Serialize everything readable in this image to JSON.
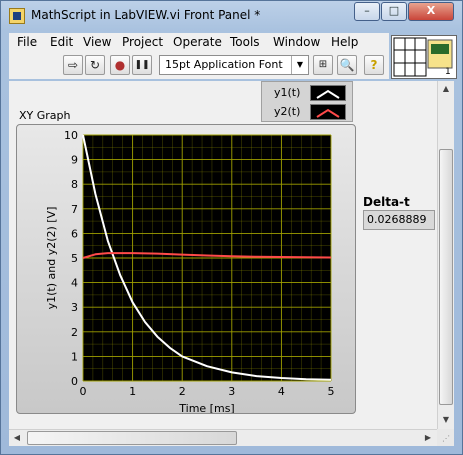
{
  "window": {
    "title": "MathScript in LabVIEW.vi Front Panel *",
    "controls": {
      "minimize": "–",
      "maximize": "□",
      "close": "X"
    }
  },
  "menu": [
    "File",
    "Edit",
    "View",
    "Project",
    "Operate",
    "Tools",
    "Window",
    "Help"
  ],
  "toolbar": {
    "buttons": [
      {
        "name": "run-button",
        "icon": "run-arrow-icon",
        "glyph": "⇨"
      },
      {
        "name": "run-continuously-button",
        "icon": "run-continuously-icon",
        "glyph": "↻"
      },
      {
        "name": "abort-button",
        "icon": "abort-stop-icon",
        "glyph": "●"
      },
      {
        "name": "pause-button",
        "icon": "pause-icon",
        "glyph": "❚❚"
      }
    ],
    "font_select": "15pt Application Font",
    "align_icon": "align-objects-icon",
    "search_icon": "search-icon",
    "help_icon": "help-icon",
    "help_glyph": "?"
  },
  "graph": {
    "label": "XY Graph",
    "legend": [
      {
        "name": "y1(t)",
        "color": "#ffffff"
      },
      {
        "name": "y2(t)",
        "color": "#ff4a4a"
      }
    ]
  },
  "delta": {
    "label": "Delta-t",
    "value": "0.0268889"
  },
  "chart_data": {
    "type": "line",
    "title": "",
    "xlabel": "Time [ms]",
    "ylabel": "y1(t) and y2(2) [V]",
    "xlim": [
      0,
      5
    ],
    "ylim": [
      0,
      10
    ],
    "xticks": [
      "0",
      "1",
      "2",
      "3",
      "4",
      "5"
    ],
    "yticks": [
      "0",
      "1",
      "2",
      "3",
      "4",
      "5",
      "6",
      "7",
      "8",
      "9",
      "10"
    ],
    "grid": true,
    "background": "#000000",
    "grid_color": "#a0a000",
    "series": [
      {
        "name": "y1(t)",
        "color": "#ffffff",
        "x": [
          0,
          0.25,
          0.5,
          0.75,
          1.0,
          1.25,
          1.5,
          1.75,
          2.0,
          2.5,
          3.0,
          3.5,
          4.0,
          4.5,
          5.0
        ],
        "y": [
          10,
          7.6,
          5.7,
          4.3,
          3.2,
          2.4,
          1.8,
          1.35,
          1.0,
          0.6,
          0.35,
          0.2,
          0.12,
          0.07,
          0.05
        ]
      },
      {
        "name": "y2(t)",
        "color": "#ff4a4a",
        "x": [
          0,
          0.25,
          0.5,
          0.75,
          1.0,
          1.5,
          2.0,
          2.5,
          3.0,
          3.5,
          4.0,
          4.5,
          5.0
        ],
        "y": [
          5.0,
          5.15,
          5.2,
          5.2,
          5.2,
          5.18,
          5.14,
          5.1,
          5.07,
          5.05,
          5.04,
          5.03,
          5.02
        ]
      }
    ]
  }
}
